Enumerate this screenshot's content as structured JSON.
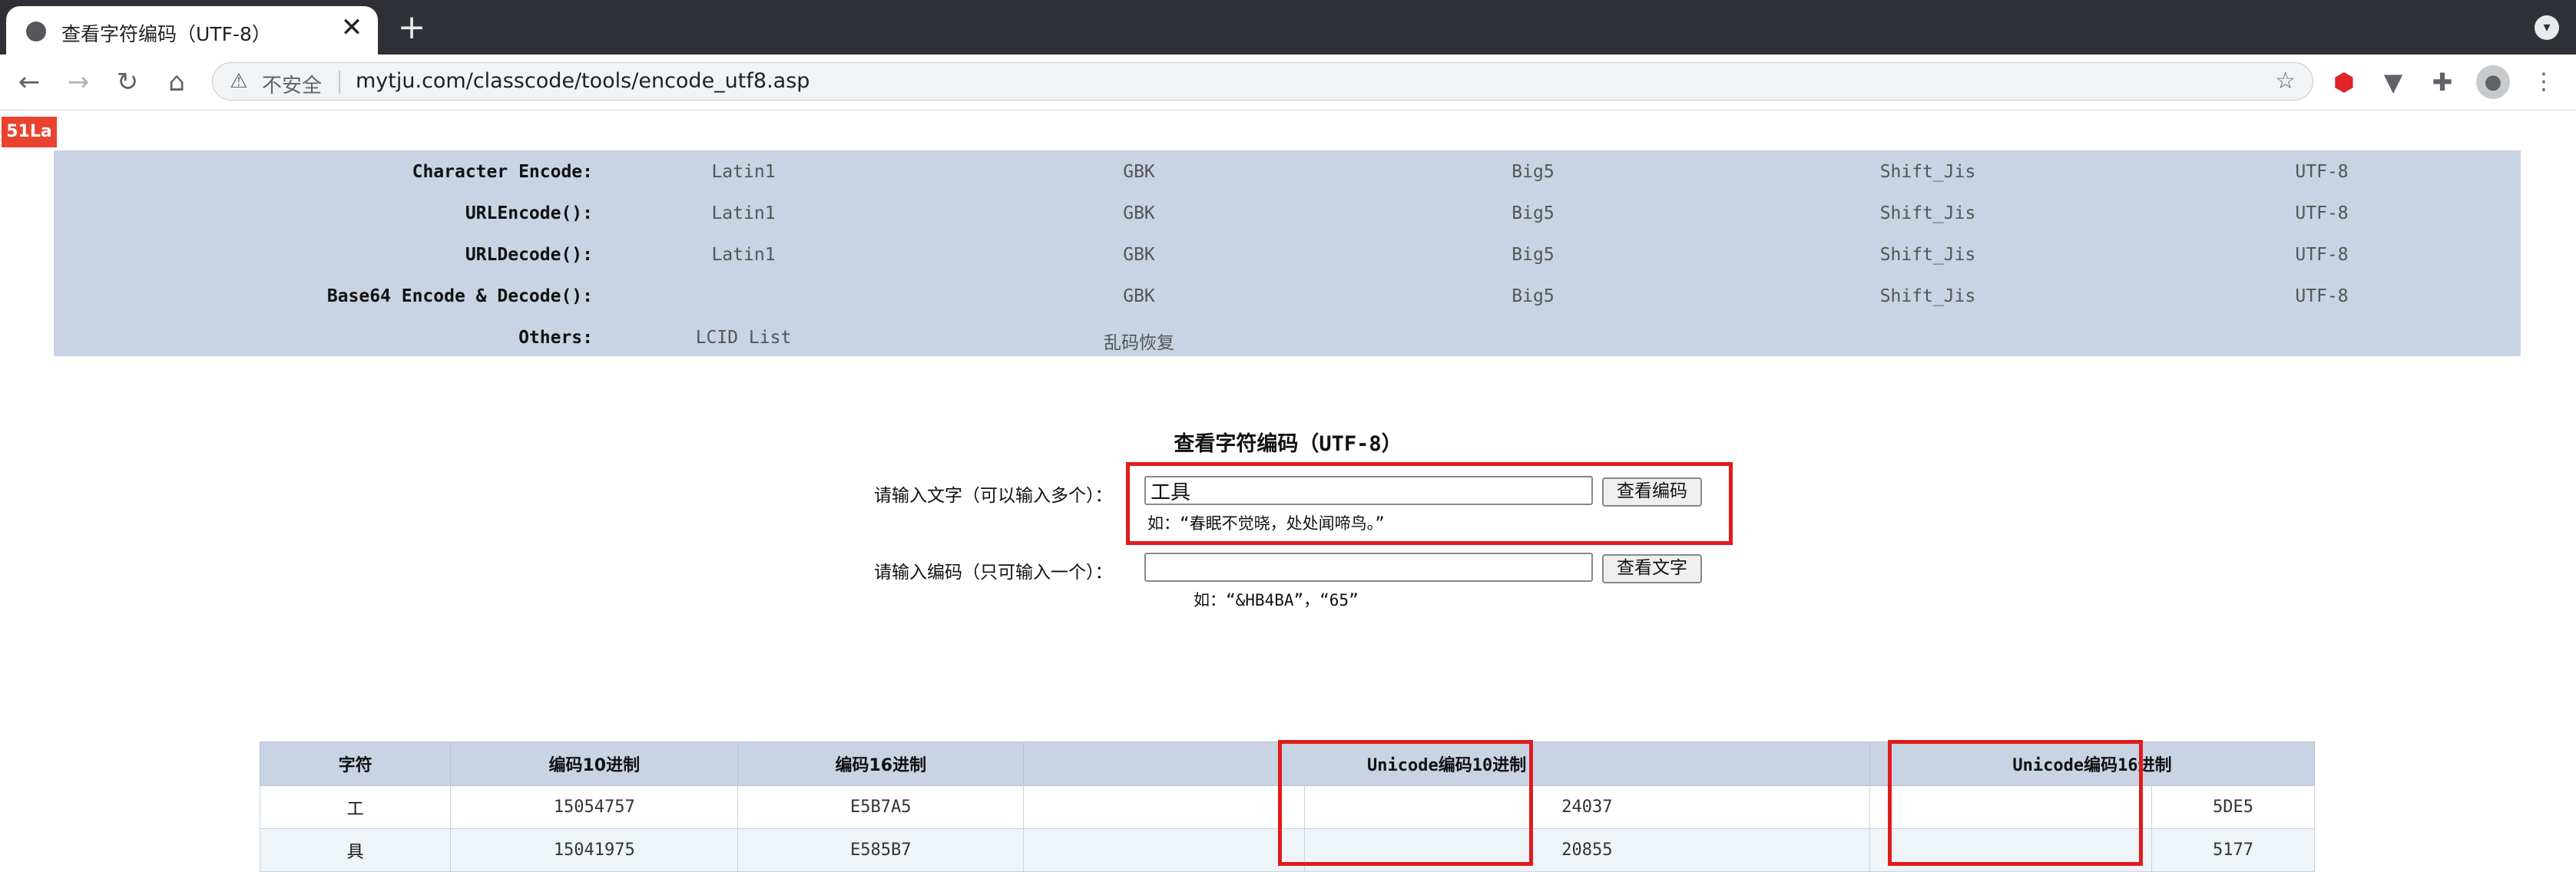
{
  "browser": {
    "tab_title": "查看字符编码（UTF-8）",
    "tab_close": "✕",
    "new_tab": "+",
    "tab_menu": "▾",
    "security_label": "不安全",
    "url": "mytju.com/classcode/tools/encode_utf8.asp",
    "icons": [
      "globe-icon",
      "close-icon",
      "plus-icon",
      "back-arrow-icon",
      "forward-arrow-icon",
      "reload-icon",
      "home-icon",
      "warning-icon",
      "star-icon",
      "adblock-icon",
      "extension-icon",
      "puzzle-icon",
      "avatar-icon",
      "kebab-menu-icon"
    ]
  },
  "badge": "51La",
  "encodings": {
    "rows": [
      {
        "label": "Character Encode:",
        "cells": [
          "Latin1",
          "GBK",
          "Big5",
          "Shift_Jis",
          "UTF-8"
        ]
      },
      {
        "label": "URLEncode():",
        "cells": [
          "Latin1",
          "GBK",
          "Big5",
          "Shift_Jis",
          "UTF-8"
        ]
      },
      {
        "label": "URLDecode():",
        "cells": [
          "Latin1",
          "GBK",
          "Big5",
          "Shift_Jis",
          "UTF-8"
        ]
      },
      {
        "label": "Base64 Encode & Decode():",
        "cells": [
          "",
          "GBK",
          "Big5",
          "Shift_Jis",
          "UTF-8"
        ]
      },
      {
        "label": "Others:",
        "cells": [
          "LCID List",
          "乱码恢复",
          "",
          "",
          ""
        ]
      }
    ]
  },
  "form": {
    "heading": "查看字符编码（UTF-8）",
    "text_label": "请输入文字（可以输入多个）：",
    "text_value": "工具",
    "text_button": "查看编码",
    "text_example": "如：“春眠不觉晓，处处闻啼鸟。”",
    "code_label": "请输入编码（只可输入一个）：",
    "code_value": "",
    "code_button": "查看文字",
    "code_example": "如：“&HB4BA”，“65”"
  },
  "results": {
    "headers": [
      "字符",
      "编码10进制",
      "编码16进制",
      "Unicode编码10进制",
      "",
      "Unicode编码16进制",
      ""
    ],
    "rows": [
      [
        "工",
        "15054757",
        "E5B7A5",
        "",
        "24037",
        "",
        "5DE5",
        ""
      ],
      [
        "具",
        "15041975",
        "E585B7",
        "",
        "20855",
        "",
        "5177",
        ""
      ]
    ]
  },
  "colors": {
    "highlight": "#e01b1b",
    "table_header_bg": "#c8d3e3",
    "alt_row_bg": "#eef4f8",
    "badge_bg": "#e9432f"
  }
}
